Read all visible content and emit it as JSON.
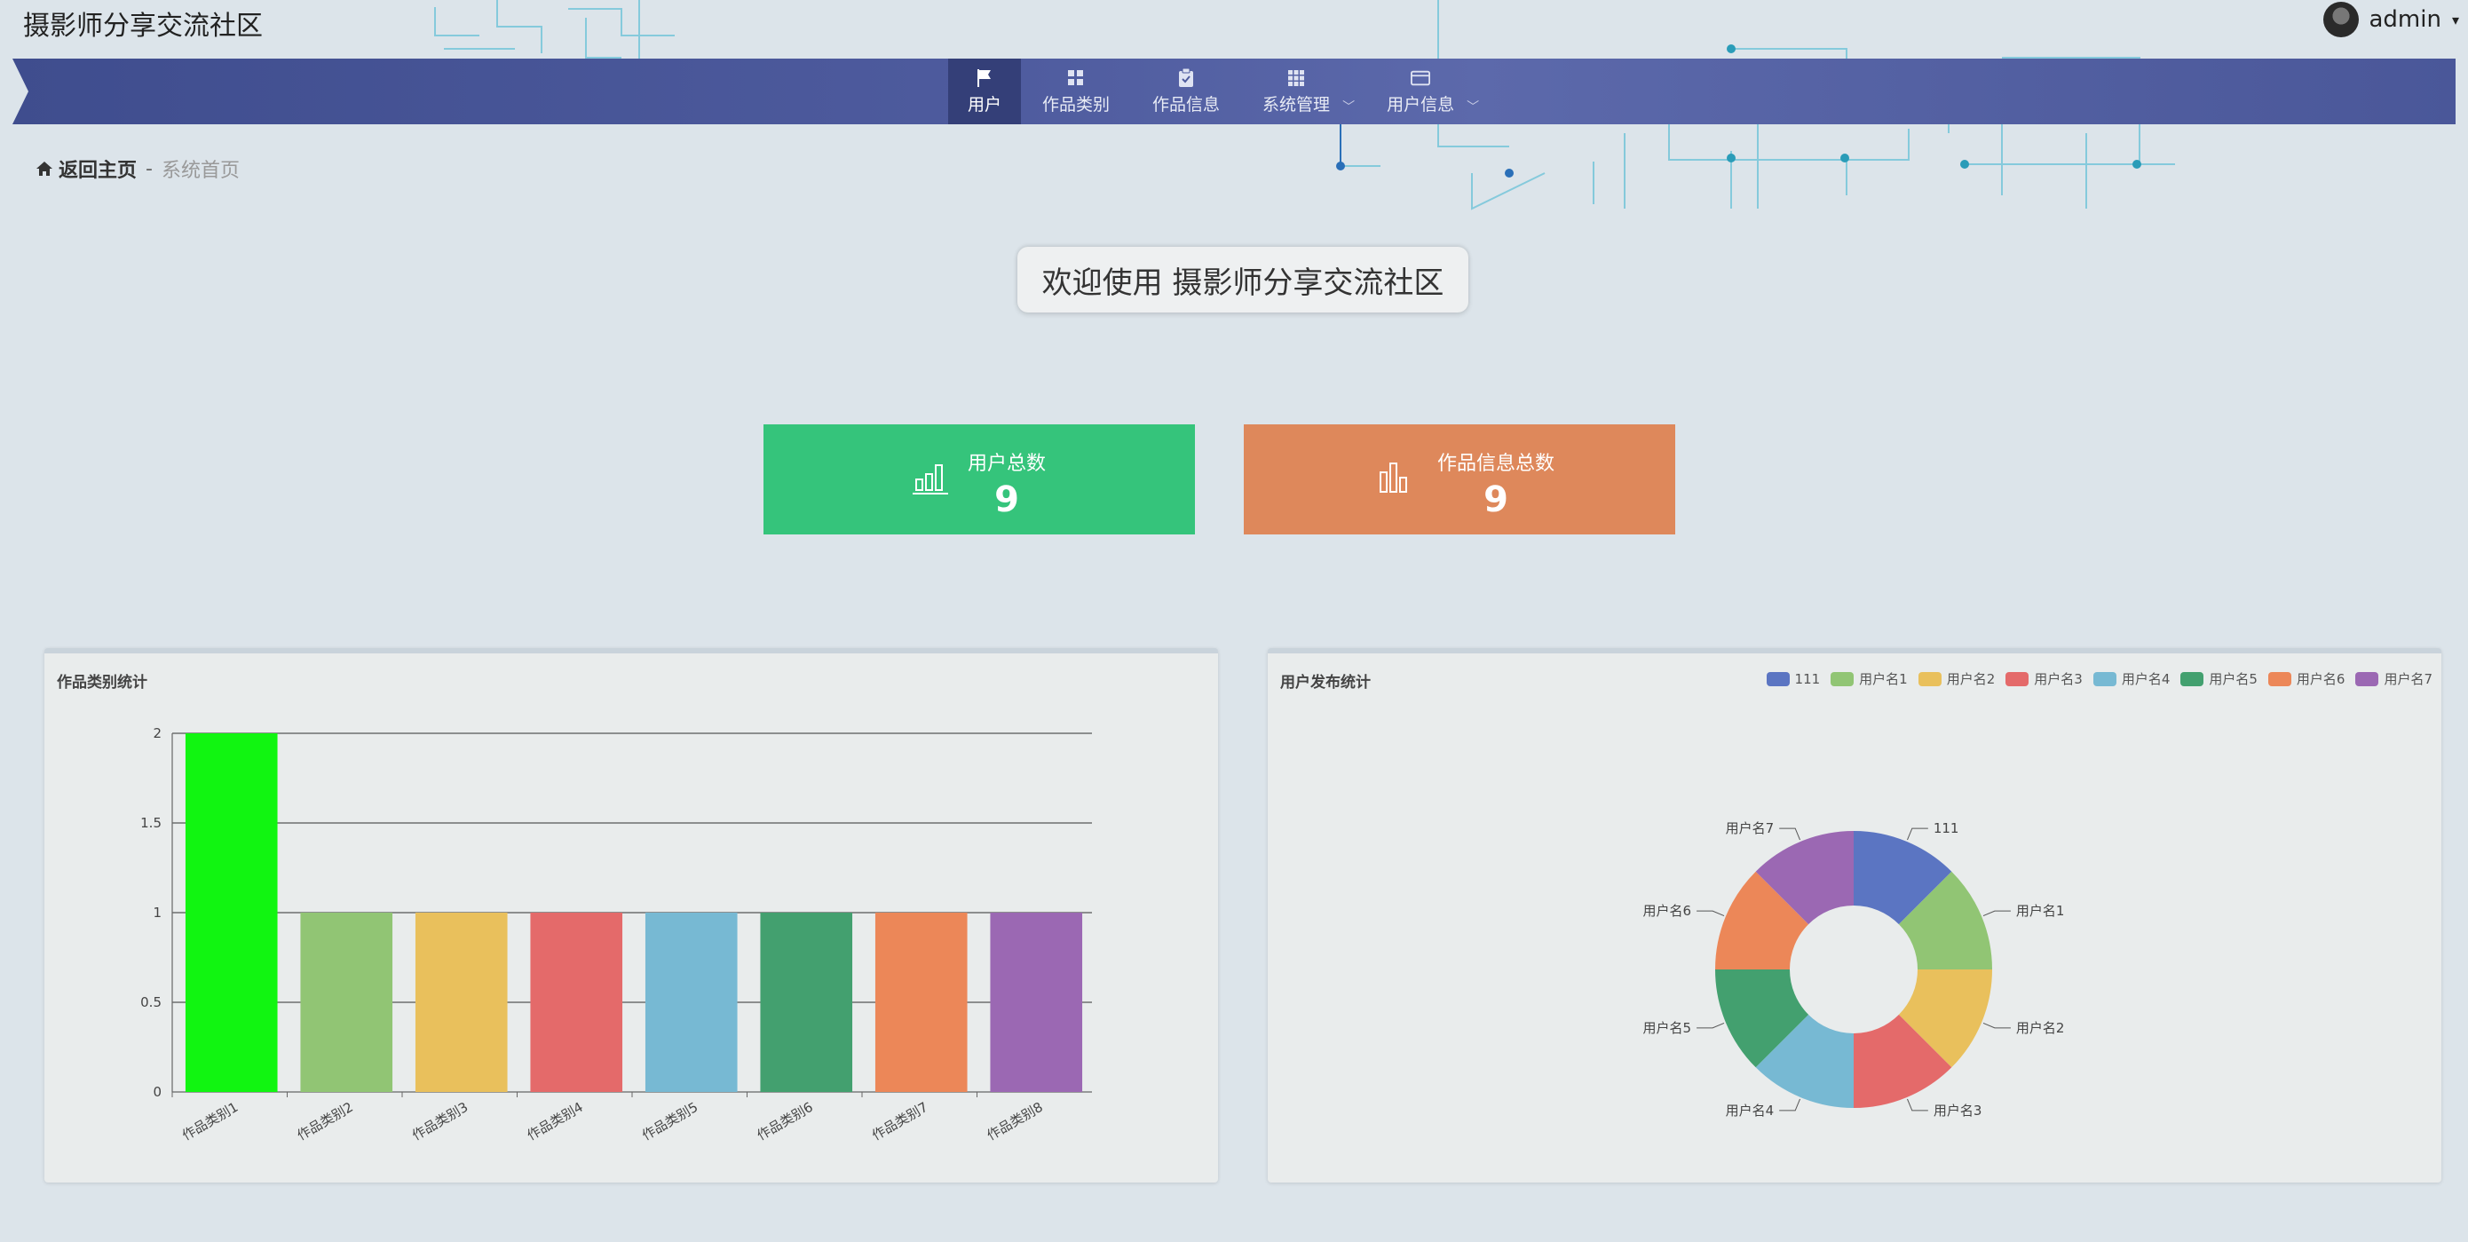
{
  "app_title": "摄影师分享交流社区",
  "user": {
    "name": "admin"
  },
  "nav": {
    "items": [
      {
        "label": "用户",
        "icon": "flag-icon",
        "active": true
      },
      {
        "label": "作品类别",
        "icon": "grid-icon"
      },
      {
        "label": "作品信息",
        "icon": "clipboard-icon"
      },
      {
        "label": "系统管理",
        "icon": "apps-icon",
        "dropdown": true
      },
      {
        "label": "用户信息",
        "icon": "card-icon",
        "dropdown": true
      }
    ]
  },
  "breadcrumb": {
    "home": "返回主页",
    "separator": "-",
    "current": "系统首页"
  },
  "welcome": "欢迎使用 摄影师分享交流社区",
  "stats": {
    "users": {
      "label": "用户总数",
      "value": "9"
    },
    "works": {
      "label": "作品信息总数",
      "value": "9"
    }
  },
  "colors": {
    "nav": "#4e5b9e",
    "stat_users": "#35c47b",
    "stat_works": "#de885b"
  },
  "chart_data": [
    {
      "type": "bar",
      "title": "作品类别统计",
      "categories": [
        "作品类别1",
        "作品类别2",
        "作品类别3",
        "作品类别4",
        "作品类别5",
        "作品类别6",
        "作品类别7",
        "作品类别8"
      ],
      "values": [
        2,
        1,
        1,
        1,
        1,
        1,
        1,
        1
      ],
      "colors": [
        "#11f511",
        "#91c574",
        "#e9c05c",
        "#e46a6a",
        "#77b9d3",
        "#43a06f",
        "#ec8758",
        "#9b68b3"
      ],
      "yticks": [
        "0",
        "0.5",
        "1",
        "1.5",
        "2"
      ],
      "ylim": [
        0,
        2
      ],
      "grid": true
    },
    {
      "type": "pie",
      "title": "用户发布统计",
      "legend_position": "top-right",
      "labels": [
        "111",
        "用户名1",
        "用户名2",
        "用户名3",
        "用户名4",
        "用户名5",
        "用户名6",
        "用户名7"
      ],
      "values": [
        1,
        1,
        1,
        1,
        1,
        1,
        1,
        1
      ],
      "colors": [
        "#5b75c2",
        "#91c574",
        "#e9c05c",
        "#e46a6a",
        "#77b9d3",
        "#43a06f",
        "#ec8758",
        "#9b68b3"
      ]
    }
  ]
}
